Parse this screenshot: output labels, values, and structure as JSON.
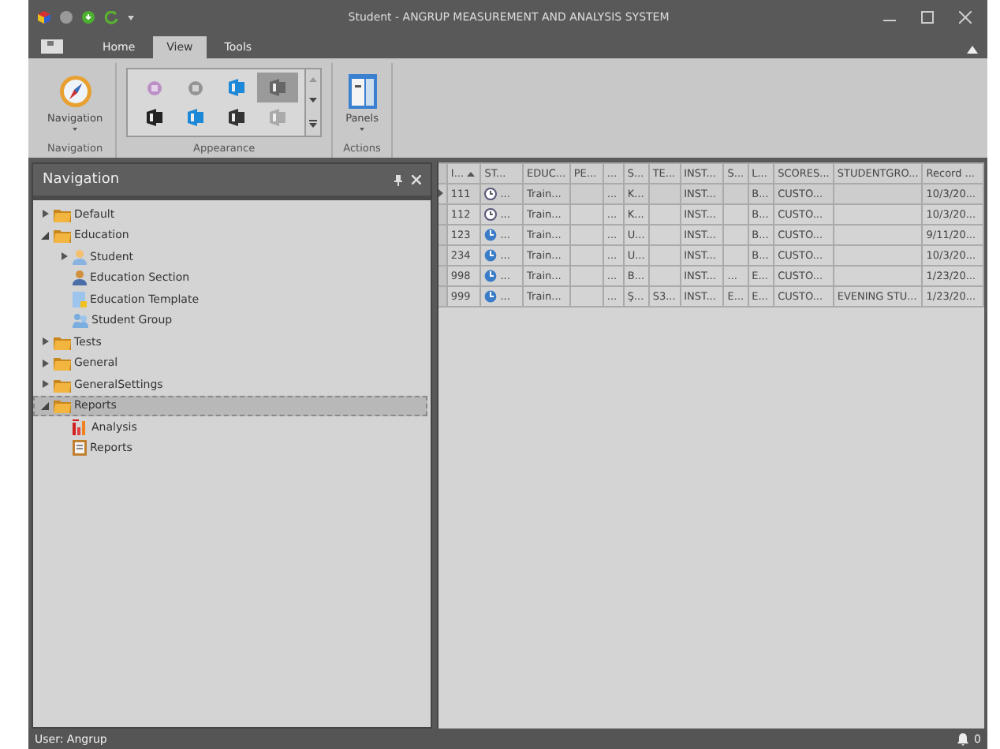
{
  "window": {
    "title": "Student - ANGRUP MEASUREMENT AND ANALYSIS SYSTEM"
  },
  "ribbon": {
    "tabs": [
      {
        "label": "Home",
        "selected": false
      },
      {
        "label": "View",
        "selected": true
      },
      {
        "label": "Tools",
        "selected": false
      }
    ],
    "groups": [
      {
        "kind": "button",
        "caption": "Navigation",
        "button": "Navigation"
      },
      {
        "kind": "gallery",
        "caption": "Appearance",
        "items": [
          {
            "selected": false
          },
          {
            "selected": false
          },
          {
            "selected": false
          },
          {
            "selected": true
          },
          {
            "selected": false
          },
          {
            "selected": false
          },
          {
            "selected": false
          },
          {
            "selected": false
          }
        ]
      },
      {
        "kind": "button",
        "caption": "Actions",
        "button": "Panels"
      }
    ]
  },
  "navigation": {
    "title": "Navigation",
    "tree": [
      {
        "label": "Default",
        "kind": "folder",
        "expanded": false,
        "selected": false
      },
      {
        "label": "Education",
        "kind": "folder",
        "expanded": true,
        "selected": false,
        "children": [
          {
            "label": "Student",
            "kind": "person",
            "expanded": false,
            "selected": false
          },
          {
            "label": "Education Section",
            "kind": "section",
            "selected": false
          },
          {
            "label": "Education Template",
            "kind": "template",
            "selected": false
          },
          {
            "label": "Student Group",
            "kind": "group",
            "selected": false
          }
        ]
      },
      {
        "label": "Tests",
        "kind": "folder",
        "expanded": false,
        "selected": false
      },
      {
        "label": "General",
        "kind": "folder",
        "expanded": false,
        "selected": false
      },
      {
        "label": "GeneralSettings",
        "kind": "folder",
        "expanded": false,
        "selected": false
      },
      {
        "label": "Reports",
        "kind": "folder",
        "expanded": true,
        "selected": true,
        "children": [
          {
            "label": "Analysis",
            "kind": "chart",
            "selected": false
          },
          {
            "label": "Reports",
            "kind": "report",
            "selected": false
          }
        ]
      }
    ]
  },
  "table": {
    "columns": [
      "I...",
      "ST...",
      "EDUC...",
      "PE...",
      "...",
      "S...",
      "TE...",
      "INST...",
      "S...",
      "L...",
      "SCORES...",
      "STUDENTGRO...",
      "Record ..."
    ],
    "rows": [
      {
        "focused": true,
        "kind": "clock",
        "cells": [
          "111",
          "...",
          "Train...",
          null,
          "...",
          "K...",
          null,
          "INST...",
          null,
          "B...",
          "CUSTO...",
          null,
          "10/3/20..."
        ]
      },
      {
        "focused": false,
        "kind": "clock",
        "cells": [
          "112",
          "...",
          "Train...",
          null,
          "...",
          "K...",
          null,
          "INST...",
          null,
          "B...",
          "CUSTO...",
          null,
          "10/3/20..."
        ]
      },
      {
        "focused": false,
        "kind": "globe",
        "cells": [
          "123",
          "...",
          "Train...",
          null,
          "...",
          "U...",
          null,
          "INST...",
          null,
          "B...",
          "CUSTO...",
          null,
          "9/11/20..."
        ]
      },
      {
        "focused": false,
        "kind": "globe",
        "cells": [
          "234",
          "...",
          "Train...",
          null,
          "...",
          "U...",
          null,
          "INST...",
          null,
          "B...",
          "CUSTO...",
          null,
          "10/3/20..."
        ]
      },
      {
        "focused": false,
        "kind": "globe",
        "cells": [
          "998",
          "...",
          "Train...",
          null,
          "...",
          "B...",
          null,
          "INST...",
          "...",
          "E...",
          "CUSTO...",
          null,
          "1/23/20..."
        ]
      },
      {
        "focused": false,
        "kind": "globe",
        "cells": [
          "999",
          "...",
          "Train...",
          null,
          "...",
          "Ş...",
          "S3...",
          "INST...",
          "E...",
          "E...",
          "CUSTO...",
          "EVENING STU...",
          "1/23/20..."
        ]
      }
    ]
  },
  "status_bar": {
    "user": "User: Angrup",
    "notifications": "0"
  }
}
